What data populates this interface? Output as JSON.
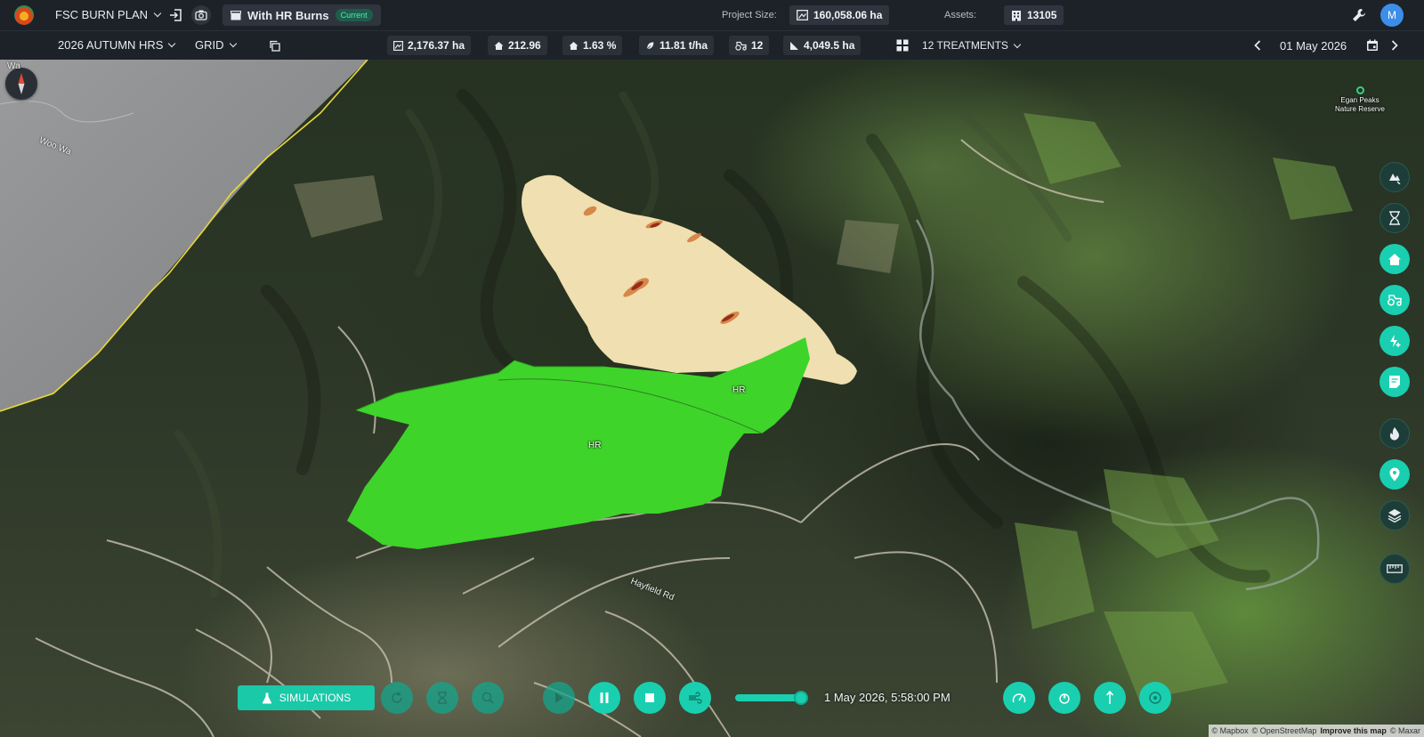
{
  "app": {
    "plan_name": "FSC BURN PLAN",
    "scenario_name": "With HR Burns",
    "scenario_badge": "Current",
    "project_size_label": "Project Size:",
    "project_size_value": "160,058.06 ha",
    "assets_label": "Assets:",
    "assets_value": "13105",
    "user_initial": "M"
  },
  "subbar": {
    "season": "2026 AUTUMN HRS",
    "view_mode": "GRID",
    "stats": [
      {
        "icon": "area-icon",
        "value": "2,176.37 ha"
      },
      {
        "icon": "house-icon",
        "value": "212.96"
      },
      {
        "icon": "house-percent-icon",
        "value": "1.63 %"
      },
      {
        "icon": "fuel-load-icon",
        "value": "11.81 t/ha"
      },
      {
        "icon": "tractor-icon",
        "value": "12"
      },
      {
        "icon": "slope-area-icon",
        "value": "4,049.5 ha"
      }
    ],
    "treatments": "12 TREATMENTS",
    "date": "01 May 2026"
  },
  "map": {
    "polygon_labels": [
      "HR",
      "HR"
    ],
    "road_labels": [
      "Hayfield Rd",
      "Woo Wa"
    ],
    "road_label_partial": "Wa",
    "poi_name": "Egan Peaks Nature Reserve",
    "attribution": {
      "mapbox": "© Mapbox",
      "osm": "© OpenStreetMap",
      "improve": "Improve this map",
      "maxar": "© Maxar"
    }
  },
  "tools": [
    "fire-spread-icon",
    "hourglass-icon",
    "home-icon",
    "tractor-icon",
    "lightning-add-icon",
    "notes-icon",
    "fire-icon",
    "location-pin-icon",
    "layers-icon",
    "ruler-icon"
  ],
  "playback": {
    "simulations_label": "SIMULATIONS",
    "time": "1 May 2026, 5:58:00 PM",
    "progress": 1.0
  },
  "colors": {
    "accent": "#19cfb0",
    "burn_polygon": "#3ed42a",
    "bar_bg": "#1d2229"
  }
}
